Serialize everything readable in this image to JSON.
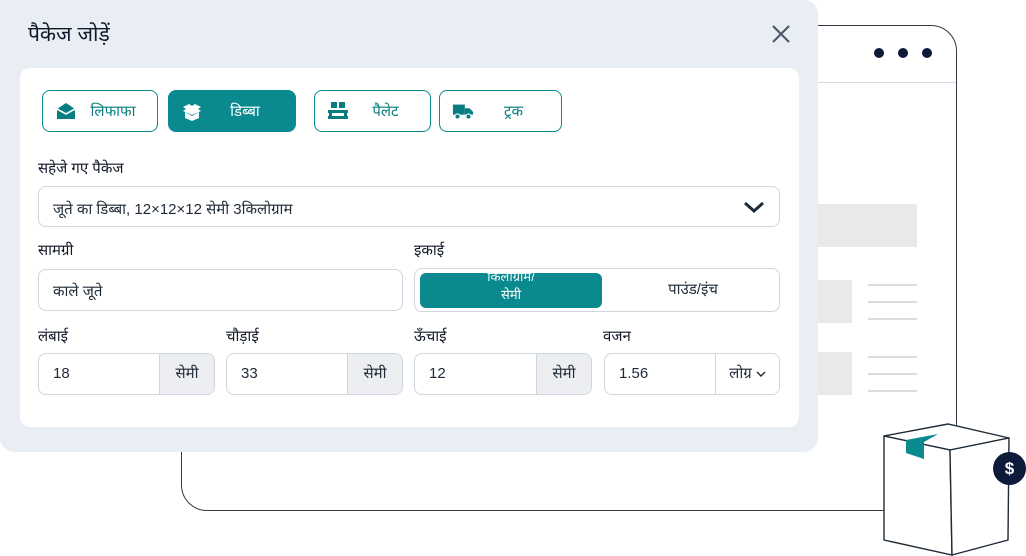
{
  "dialog": {
    "title": "पैकेज जोड़ें"
  },
  "package_types": [
    {
      "label": "लिफाफा",
      "icon": "envelope-icon",
      "active": false
    },
    {
      "label": "डिब्बा",
      "icon": "box-icon",
      "active": true
    },
    {
      "label": "पैलेट",
      "icon": "pallet-icon",
      "active": false
    },
    {
      "label": "ट्रक",
      "icon": "truck-icon",
      "active": false
    }
  ],
  "saved": {
    "label": "सहेजे गए पैकेज",
    "value": "जूते का डिब्बा, 12×12×12 सेमी 3किलोग्राम"
  },
  "content": {
    "label": "सामग्री",
    "value": "काले जूते"
  },
  "unit": {
    "label": "इकाई",
    "selected": "किलोग्राम/सेमी",
    "other": "पाउंड/इंच"
  },
  "dims": {
    "length": {
      "label": "लंबाई",
      "value": "18",
      "unit": "सेमी"
    },
    "width": {
      "label": "चौड़ाई",
      "value": "33",
      "unit": "सेमी"
    },
    "height": {
      "label": "ऊँचाई",
      "value": "12",
      "unit": "सेमी"
    },
    "weight": {
      "label": "वजन",
      "value": "1.56",
      "unit": "लोग्र"
    }
  },
  "colors": {
    "accent": "#0a8a8e",
    "modal_bg": "#e9eef5",
    "dark": "#0e1a3a"
  },
  "badge": {
    "symbol": "$"
  }
}
